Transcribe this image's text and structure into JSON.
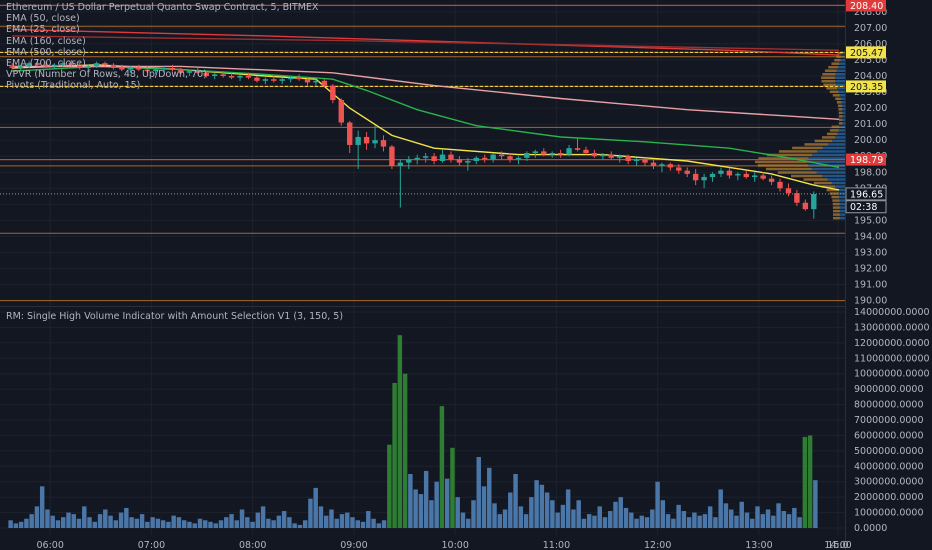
{
  "legend": {
    "title": "Ethereum / US Dollar Perpetual Quanto Swap Contract, 5, BITMEX",
    "lines": [
      "EMA (50, close)",
      "EMA (25, close)",
      "EMA (160, close)",
      "EMA (500, close)",
      "EMA (700, close)",
      "VPVR (Number Of Rows, 48, Up/Down, 70)",
      "Pivots (Traditional, Auto, 15)"
    ]
  },
  "volume_panel": {
    "title": "RM: Single High Volume Indicator with Amount Selection V1 (3, 150, 5)"
  },
  "colors": {
    "background": "#131722",
    "grid": "#1e222d",
    "text": "#b2b5be",
    "up": "#26a69a",
    "down": "#ef5350",
    "vol_normal": "#4a76a8",
    "vol_high": "#2e7d32",
    "ema50": "#29b34a",
    "ema25": "#f2e349",
    "ema160": "#e8a0a5",
    "ema500": "#e03a3a",
    "ema700": "#9c2f2f",
    "vpvr_up": "#2a6fb0",
    "vpvr_down": "#e6a23c",
    "pivot": "#c97a2c"
  },
  "chart_data": [
    {
      "type": "candlestick",
      "title": "Ethereum / US Dollar Perpetual Quanto Swap Contract, 5, BITMEX",
      "x_ticks": [
        "06:00",
        "07:00",
        "08:00",
        "09:00",
        "10:00",
        "11:00",
        "12:00",
        "13:00",
        "14:00",
        "15:0"
      ],
      "y_ticks": [
        "190.00",
        "191.00",
        "192.00",
        "193.00",
        "194.00",
        "195.00",
        "196.00",
        "197.00",
        "198.00",
        "199.00",
        "200.00",
        "201.00",
        "202.00",
        "203.00",
        "204.00",
        "205.00",
        "206.00",
        "207.00",
        "208.00"
      ],
      "ylim": [
        189.85,
        208.55
      ],
      "price_labels": [
        {
          "text": "208.40",
          "color": "#e03a3a"
        },
        {
          "text": "205.47",
          "color": "#f2e349"
        },
        {
          "text": "203.35",
          "color": "#f2e349"
        },
        {
          "text": "198.79",
          "color": "#e03a3a"
        },
        {
          "text": "196.65",
          "color": "#ffffff"
        },
        {
          "text": "02:38",
          "color": "#ffffff"
        }
      ],
      "pivot_levels": [
        208.4,
        207.1,
        205.47,
        205.2,
        203.35,
        200.8,
        198.79,
        198.4,
        194.2,
        190.0
      ],
      "candles": [
        {
          "o": 204.6,
          "h": 204.8,
          "l": 204.4,
          "c": 204.5
        },
        {
          "o": 204.5,
          "h": 204.7,
          "l": 204.3,
          "c": 204.6
        },
        {
          "o": 204.6,
          "h": 204.9,
          "l": 204.5,
          "c": 204.8
        },
        {
          "o": 204.8,
          "h": 205.0,
          "l": 204.6,
          "c": 204.7
        },
        {
          "o": 204.7,
          "h": 204.9,
          "l": 204.5,
          "c": 204.6
        },
        {
          "o": 204.6,
          "h": 204.8,
          "l": 204.4,
          "c": 204.7
        },
        {
          "o": 204.7,
          "h": 204.9,
          "l": 204.6,
          "c": 204.8
        },
        {
          "o": 204.8,
          "h": 205.0,
          "l": 204.6,
          "c": 204.7
        },
        {
          "o": 204.7,
          "h": 204.8,
          "l": 204.4,
          "c": 204.5
        },
        {
          "o": 204.5,
          "h": 204.7,
          "l": 204.3,
          "c": 204.6
        },
        {
          "o": 204.6,
          "h": 204.9,
          "l": 204.5,
          "c": 204.8
        },
        {
          "o": 204.8,
          "h": 204.9,
          "l": 204.6,
          "c": 204.7
        },
        {
          "o": 204.7,
          "h": 204.8,
          "l": 204.4,
          "c": 204.5
        },
        {
          "o": 204.5,
          "h": 204.7,
          "l": 204.3,
          "c": 204.4
        },
        {
          "o": 204.4,
          "h": 204.6,
          "l": 204.2,
          "c": 204.5
        },
        {
          "o": 204.5,
          "h": 204.7,
          "l": 204.3,
          "c": 204.4
        },
        {
          "o": 204.4,
          "h": 204.6,
          "l": 204.2,
          "c": 204.3
        },
        {
          "o": 204.3,
          "h": 204.5,
          "l": 204.1,
          "c": 204.4
        },
        {
          "o": 204.4,
          "h": 204.6,
          "l": 204.2,
          "c": 204.5
        },
        {
          "o": 204.5,
          "h": 204.7,
          "l": 204.3,
          "c": 204.4
        },
        {
          "o": 204.4,
          "h": 204.5,
          "l": 204.1,
          "c": 204.2
        },
        {
          "o": 204.2,
          "h": 204.4,
          "l": 204.0,
          "c": 204.3
        },
        {
          "o": 204.3,
          "h": 204.5,
          "l": 204.1,
          "c": 204.2
        },
        {
          "o": 204.2,
          "h": 204.3,
          "l": 203.9,
          "c": 204.0
        },
        {
          "o": 204.0,
          "h": 204.2,
          "l": 203.8,
          "c": 204.1
        },
        {
          "o": 204.1,
          "h": 204.3,
          "l": 203.9,
          "c": 204.0
        },
        {
          "o": 204.0,
          "h": 204.2,
          "l": 203.8,
          "c": 203.9
        },
        {
          "o": 203.9,
          "h": 204.1,
          "l": 203.7,
          "c": 204.0
        },
        {
          "o": 204.0,
          "h": 204.2,
          "l": 203.8,
          "c": 203.9
        },
        {
          "o": 203.9,
          "h": 204.0,
          "l": 203.6,
          "c": 203.7
        },
        {
          "o": 203.7,
          "h": 203.9,
          "l": 203.5,
          "c": 203.8
        },
        {
          "o": 203.8,
          "h": 204.0,
          "l": 203.6,
          "c": 203.7
        },
        {
          "o": 203.7,
          "h": 203.9,
          "l": 203.5,
          "c": 203.8
        },
        {
          "o": 203.8,
          "h": 204.0,
          "l": 203.6,
          "c": 203.9
        },
        {
          "o": 203.9,
          "h": 204.1,
          "l": 203.7,
          "c": 203.8
        },
        {
          "o": 203.8,
          "h": 203.9,
          "l": 203.4,
          "c": 203.6
        },
        {
          "o": 203.6,
          "h": 203.8,
          "l": 203.4,
          "c": 203.7
        },
        {
          "o": 203.7,
          "h": 203.8,
          "l": 203.3,
          "c": 203.4
        },
        {
          "o": 203.4,
          "h": 203.5,
          "l": 202.3,
          "c": 202.5
        },
        {
          "o": 202.5,
          "h": 202.6,
          "l": 200.9,
          "c": 201.1
        },
        {
          "o": 201.1,
          "h": 201.2,
          "l": 199.2,
          "c": 199.7
        },
        {
          "o": 199.7,
          "h": 200.6,
          "l": 198.2,
          "c": 200.2
        },
        {
          "o": 200.2,
          "h": 200.5,
          "l": 199.4,
          "c": 199.8
        },
        {
          "o": 199.8,
          "h": 200.9,
          "l": 199.5,
          "c": 200.0
        },
        {
          "o": 200.0,
          "h": 200.3,
          "l": 199.3,
          "c": 199.6
        },
        {
          "o": 199.6,
          "h": 199.7,
          "l": 198.2,
          "c": 198.4
        },
        {
          "o": 198.4,
          "h": 198.8,
          "l": 195.8,
          "c": 198.6
        },
        {
          "o": 198.6,
          "h": 199.0,
          "l": 198.2,
          "c": 198.8
        },
        {
          "o": 198.8,
          "h": 199.1,
          "l": 198.5,
          "c": 198.9
        },
        {
          "o": 198.9,
          "h": 199.2,
          "l": 198.6,
          "c": 199.0
        },
        {
          "o": 199.0,
          "h": 199.2,
          "l": 198.5,
          "c": 198.7
        },
        {
          "o": 198.7,
          "h": 199.4,
          "l": 198.6,
          "c": 199.1
        },
        {
          "o": 199.1,
          "h": 199.3,
          "l": 198.6,
          "c": 198.8
        },
        {
          "o": 198.8,
          "h": 199.0,
          "l": 198.4,
          "c": 198.6
        },
        {
          "o": 198.6,
          "h": 198.9,
          "l": 198.1,
          "c": 198.7
        },
        {
          "o": 198.7,
          "h": 199.0,
          "l": 198.5,
          "c": 198.9
        },
        {
          "o": 198.9,
          "h": 199.1,
          "l": 198.6,
          "c": 198.8
        },
        {
          "o": 198.8,
          "h": 199.2,
          "l": 198.6,
          "c": 199.1
        },
        {
          "o": 199.1,
          "h": 199.3,
          "l": 198.8,
          "c": 199.0
        },
        {
          "o": 199.0,
          "h": 199.2,
          "l": 198.6,
          "c": 198.8
        },
        {
          "o": 198.8,
          "h": 199.0,
          "l": 198.5,
          "c": 198.9
        },
        {
          "o": 198.9,
          "h": 199.3,
          "l": 198.7,
          "c": 199.2
        },
        {
          "o": 199.2,
          "h": 199.4,
          "l": 198.9,
          "c": 199.3
        },
        {
          "o": 199.3,
          "h": 199.5,
          "l": 199.0,
          "c": 199.1
        },
        {
          "o": 199.1,
          "h": 199.3,
          "l": 198.9,
          "c": 199.2
        },
        {
          "o": 199.2,
          "h": 199.4,
          "l": 198.9,
          "c": 199.1
        },
        {
          "o": 199.1,
          "h": 199.7,
          "l": 199.0,
          "c": 199.5
        },
        {
          "o": 199.5,
          "h": 200.1,
          "l": 199.3,
          "c": 199.4
        },
        {
          "o": 199.4,
          "h": 199.6,
          "l": 199.1,
          "c": 199.2
        },
        {
          "o": 199.2,
          "h": 199.4,
          "l": 198.9,
          "c": 199.0
        },
        {
          "o": 199.0,
          "h": 199.2,
          "l": 198.8,
          "c": 199.1
        },
        {
          "o": 199.1,
          "h": 199.3,
          "l": 198.8,
          "c": 198.9
        },
        {
          "o": 198.9,
          "h": 199.1,
          "l": 198.6,
          "c": 199.0
        },
        {
          "o": 199.0,
          "h": 199.1,
          "l": 198.5,
          "c": 198.7
        },
        {
          "o": 198.7,
          "h": 198.9,
          "l": 198.4,
          "c": 198.8
        },
        {
          "o": 198.8,
          "h": 198.9,
          "l": 198.4,
          "c": 198.6
        },
        {
          "o": 198.6,
          "h": 198.8,
          "l": 198.2,
          "c": 198.4
        },
        {
          "o": 198.4,
          "h": 198.6,
          "l": 198.0,
          "c": 198.5
        },
        {
          "o": 198.5,
          "h": 198.6,
          "l": 198.1,
          "c": 198.3
        },
        {
          "o": 198.3,
          "h": 198.5,
          "l": 197.9,
          "c": 198.1
        },
        {
          "o": 198.1,
          "h": 198.3,
          "l": 197.7,
          "c": 197.9
        },
        {
          "o": 197.9,
          "h": 198.2,
          "l": 197.2,
          "c": 197.5
        },
        {
          "o": 197.5,
          "h": 197.9,
          "l": 197.0,
          "c": 197.7
        },
        {
          "o": 197.7,
          "h": 198.0,
          "l": 197.4,
          "c": 197.9
        },
        {
          "o": 197.9,
          "h": 198.3,
          "l": 197.7,
          "c": 198.1
        },
        {
          "o": 198.1,
          "h": 198.3,
          "l": 197.6,
          "c": 197.8
        },
        {
          "o": 197.8,
          "h": 198.0,
          "l": 197.5,
          "c": 197.9
        },
        {
          "o": 197.9,
          "h": 198.1,
          "l": 197.6,
          "c": 197.7
        },
        {
          "o": 197.7,
          "h": 198.0,
          "l": 197.4,
          "c": 197.8
        },
        {
          "o": 197.8,
          "h": 198.0,
          "l": 197.5,
          "c": 197.6
        },
        {
          "o": 197.6,
          "h": 197.8,
          "l": 197.2,
          "c": 197.4
        },
        {
          "o": 197.4,
          "h": 197.6,
          "l": 196.8,
          "c": 197.0
        },
        {
          "o": 197.0,
          "h": 197.3,
          "l": 196.5,
          "c": 196.7
        },
        {
          "o": 196.7,
          "h": 196.9,
          "l": 195.9,
          "c": 196.1
        },
        {
          "o": 196.1,
          "h": 196.3,
          "l": 195.6,
          "c": 195.7
        },
        {
          "o": 195.7,
          "h": 196.8,
          "l": 195.1,
          "c": 196.65
        }
      ],
      "ema_series": [
        {
          "name": "EMA (25, close)",
          "values": [
            [
              0,
              204.5
            ],
            [
              10,
              204.7
            ],
            [
              20,
              204.4
            ],
            [
              30,
              204.0
            ],
            [
              36,
              203.8
            ],
            [
              40,
              202.0
            ],
            [
              45,
              200.3
            ],
            [
              50,
              199.5
            ],
            [
              60,
              199.1
            ],
            [
              70,
              199.1
            ],
            [
              80,
              198.7
            ],
            [
              90,
              197.9
            ],
            [
              95,
              197.2
            ],
            [
              98,
              196.9
            ]
          ]
        },
        {
          "name": "EMA (50, close)",
          "values": [
            [
              0,
              204.3
            ],
            [
              10,
              204.6
            ],
            [
              20,
              204.4
            ],
            [
              30,
              204.1
            ],
            [
              38,
              203.8
            ],
            [
              42,
              203.1
            ],
            [
              48,
              201.9
            ],
            [
              55,
              200.9
            ],
            [
              65,
              200.2
            ],
            [
              75,
              199.9
            ],
            [
              85,
              199.5
            ],
            [
              92,
              198.9
            ],
            [
              98,
              198.3
            ]
          ]
        },
        {
          "name": "EMA (160, close)",
          "values": [
            [
              0,
              204.6
            ],
            [
              20,
              204.6
            ],
            [
              38,
              204.2
            ],
            [
              50,
              203.4
            ],
            [
              65,
              202.6
            ],
            [
              80,
              201.9
            ],
            [
              92,
              201.5
            ],
            [
              98,
              201.3
            ]
          ]
        },
        {
          "name": "EMA (500, close)",
          "values": [
            [
              0,
              206.9
            ],
            [
              30,
              206.5
            ],
            [
              60,
              206.0
            ],
            [
              85,
              205.6
            ],
            [
              98,
              205.3
            ]
          ]
        },
        {
          "name": "EMA (700, close)",
          "values": [
            [
              0,
              206.5
            ],
            [
              40,
              206.2
            ],
            [
              70,
              205.9
            ],
            [
              98,
              205.6
            ]
          ]
        }
      ]
    },
    {
      "type": "bar",
      "title": "RM: Single High Volume Indicator with Amount Selection V1 (3, 150, 5)",
      "y_ticks": [
        "0.0000",
        "1000000.0000",
        "2000000.0000",
        "3000000.0000",
        "4000000.0000",
        "5000000.0000",
        "6000000.0000",
        "7000000.0000",
        "8000000.0000",
        "9000000.0000",
        "10000000.0000",
        "11000000.0000",
        "12000000.0000",
        "13000000.0000",
        "14000000.0000"
      ],
      "ylim": [
        0,
        14000000
      ],
      "high_volume_threshold": 5000000,
      "values": [
        500000,
        300000,
        400000,
        600000,
        900000,
        1400000,
        2700000,
        1200000,
        800000,
        500000,
        700000,
        1000000,
        900000,
        600000,
        1400000,
        700000,
        400000,
        900000,
        1200000,
        800000,
        500000,
        1000000,
        1300000,
        700000,
        600000,
        900000,
        400000,
        700000,
        600000,
        500000,
        400000,
        800000,
        700000,
        500000,
        400000,
        300000,
        600000,
        500000,
        400000,
        300000,
        500000,
        700000,
        900000,
        500000,
        1200000,
        700000,
        400000,
        1000000,
        1400000,
        600000,
        500000,
        800000,
        1100000,
        700000,
        300000,
        200000,
        500000,
        1900000,
        2600000,
        1400000,
        800000,
        1200000,
        600000,
        900000,
        1000000,
        700000,
        500000,
        400000,
        1100000,
        600000,
        300000,
        500000,
        5400000,
        9400000,
        12500000,
        10000000,
        3500000,
        2500000,
        2200000,
        3700000,
        1800000,
        3000000,
        7900000,
        3200000,
        5200000,
        2000000,
        1000000,
        600000,
        1800000,
        4600000,
        2700000,
        3900000,
        1600000,
        900000,
        1200000,
        2300000,
        3500000,
        1400000,
        900000,
        2000000,
        3100000,
        2800000,
        2300000,
        1800000,
        1000000,
        1500000,
        2500000,
        1200000,
        1800000,
        600000,
        900000,
        800000,
        1400000,
        700000,
        1100000,
        1700000,
        2000000,
        1300000,
        1000000,
        600000,
        800000,
        700000,
        1200000,
        3000000,
        1800000,
        900000,
        600000,
        1500000,
        1100000,
        700000,
        1000000,
        800000,
        900000,
        1400000,
        700000,
        2500000,
        1600000,
        1200000,
        800000,
        1700000,
        1000000,
        600000,
        1400000,
        900000,
        1200000,
        800000,
        1600000,
        1100000,
        900000,
        1300000,
        700000,
        5900000,
        6000000,
        3100000
      ]
    }
  ]
}
